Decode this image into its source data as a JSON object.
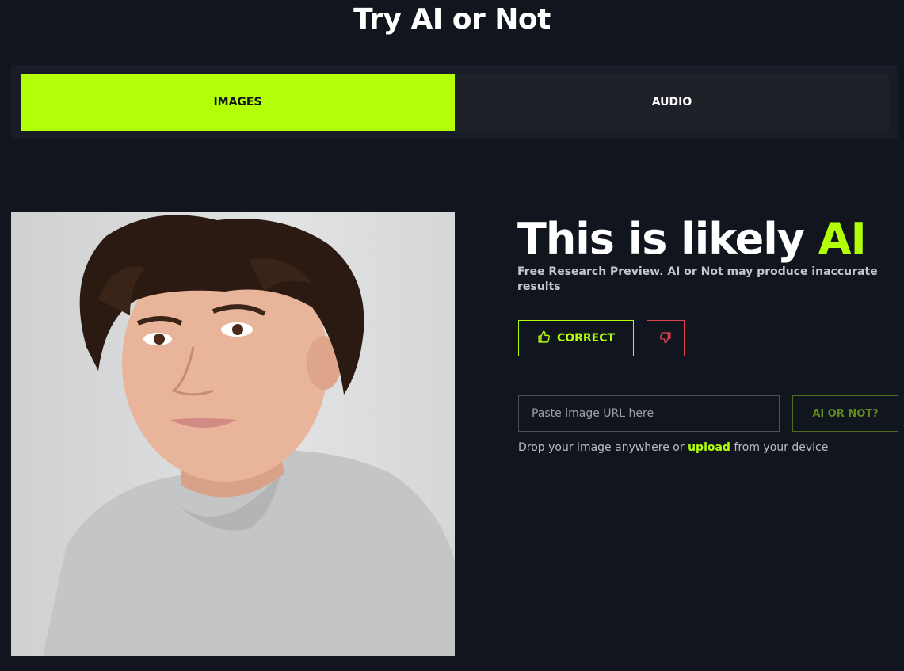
{
  "header": {
    "title": "Try AI or Not"
  },
  "tabs": [
    {
      "label": "IMAGES",
      "active": true
    },
    {
      "label": "AUDIO",
      "active": false
    }
  ],
  "result": {
    "heading_prefix": "This is likely ",
    "heading_accent": "AI",
    "disclaimer": "Free Research Preview. AI or Not may produce inaccurate results"
  },
  "feedback": {
    "correct_label": "CORRECT",
    "correct_icon": "thumbs-up-icon",
    "wrong_icon": "thumbs-down-icon"
  },
  "url_form": {
    "placeholder": "Paste image URL here",
    "value": "",
    "submit_label": "AI OR NOT?"
  },
  "drop_hint": {
    "prefix": "Drop your image anywhere or ",
    "link": "upload",
    "suffix": " from your device"
  },
  "colors": {
    "accent": "#b2ff07",
    "background": "#10151e",
    "danger": "#e0424d"
  }
}
